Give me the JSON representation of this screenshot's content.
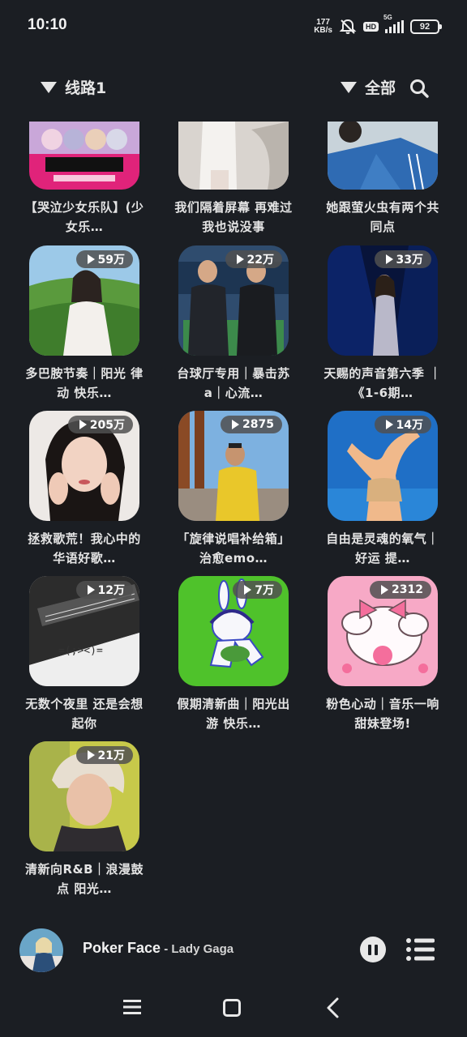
{
  "status_bar": {
    "time": "10:10",
    "net_speed_value": "177",
    "net_speed_unit": "KB/s",
    "hd_badge": "HD",
    "network": "5G",
    "battery": "92"
  },
  "filters": {
    "route_label": "线路1",
    "category_label": "全部"
  },
  "playlists": [
    {
      "title": "【哭泣少女乐队】(少女乐…",
      "plays": ""
    },
    {
      "title": "我们隔着屏幕 再难过我也说没事",
      "plays": ""
    },
    {
      "title": "她跟萤火虫有两个共同点",
      "plays": ""
    },
    {
      "title": "多巴胺节奏｜阳光 律动 快乐…",
      "plays": "59万"
    },
    {
      "title": "台球厅专用｜暴击苏a｜心流…",
      "plays": "22万"
    },
    {
      "title": "天赐的声音第六季 ｜ 《1-6期…",
      "plays": "33万"
    },
    {
      "title": "拯救歌荒！我心中的华语好歌…",
      "plays": "205万"
    },
    {
      "title": "「旋律说唱补给箱」治愈emo…",
      "plays": "2875"
    },
    {
      "title": "自由是灵魂的氧气｜好运 提…",
      "plays": "14万"
    },
    {
      "title": "无数个夜里 还是会想起你",
      "plays": "12万"
    },
    {
      "title": "假期清新曲｜阳光出游 快乐…",
      "plays": "7万"
    },
    {
      "title": "粉色心动｜音乐一响 甜妹登场!",
      "plays": "2312"
    },
    {
      "title": "清新向R&B｜浪漫鼓点 阳光…",
      "plays": "21万"
    }
  ],
  "player": {
    "song": "Poker Face",
    "separator": " - ",
    "artist": "Lady Gaga"
  },
  "icons": {
    "mute": "bell-off-icon",
    "search": "search-icon",
    "pause": "pause-icon",
    "queue": "playlist-icon",
    "nav_menu": "menu-icon",
    "nav_home": "home-icon",
    "nav_back": "back-icon"
  }
}
